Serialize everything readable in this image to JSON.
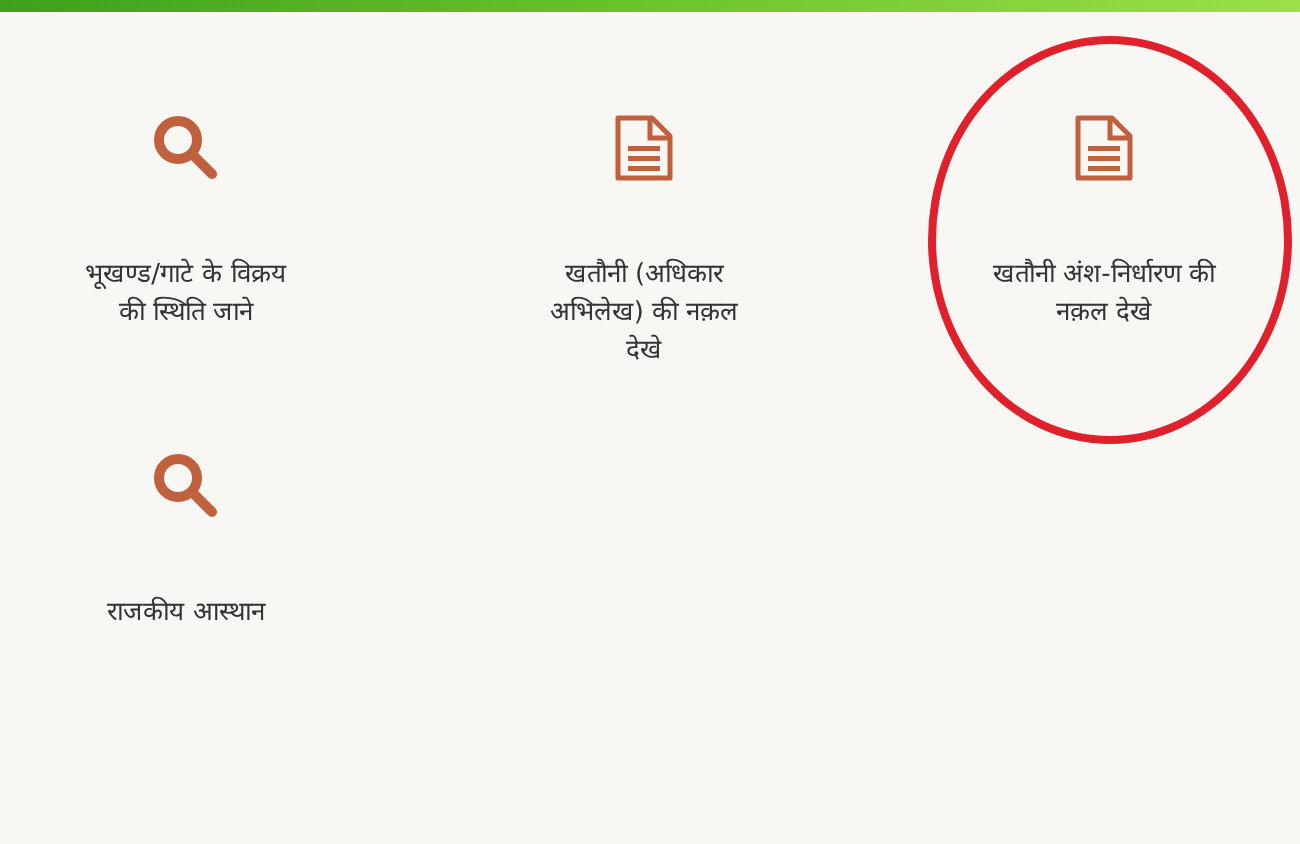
{
  "items": [
    {
      "kind": "search",
      "label": "भूखण्ड/गाटे के विक्रय की स्थिति जाने",
      "circled": false
    },
    {
      "kind": "document",
      "label": "खतौनी (अधिकार अभिलेख) की नक़ल देखे",
      "circled": false
    },
    {
      "kind": "document",
      "label": "खतौनी अंश-निर्धारण की नक़ल देखे",
      "circled": true
    },
    {
      "kind": "search",
      "label": "राजकीय आस्थान",
      "circled": false
    }
  ]
}
